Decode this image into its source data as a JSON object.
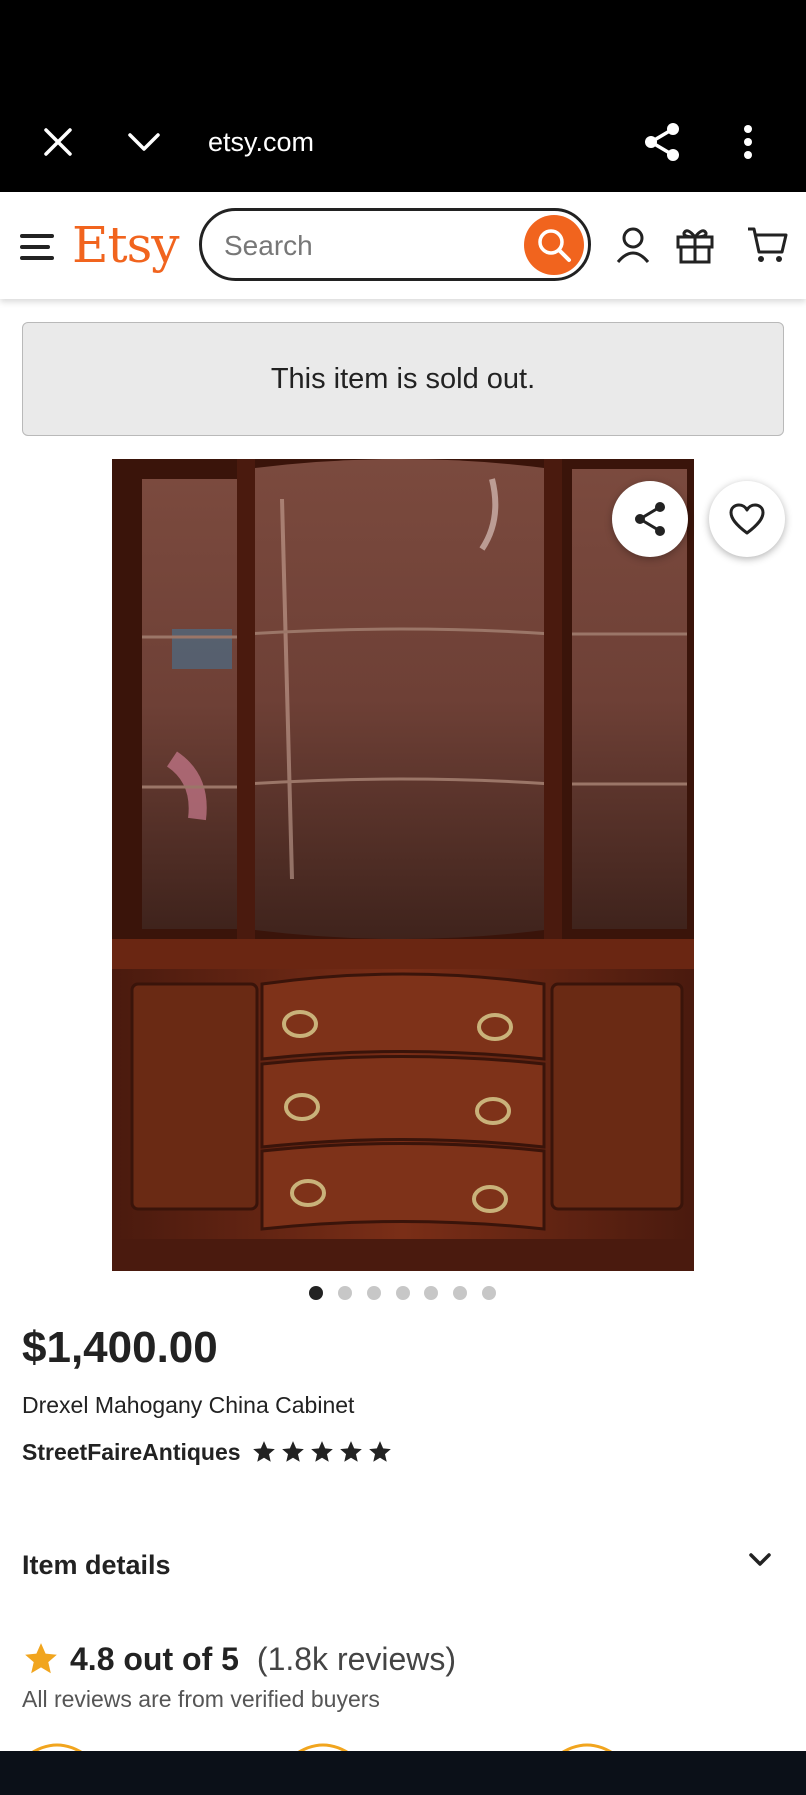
{
  "browser": {
    "url": "etsy.com"
  },
  "header": {
    "logo": "Etsy",
    "search_placeholder": "Search",
    "brand_color": "#F1641E"
  },
  "notice": {
    "sold_out": "This item is sold out."
  },
  "gallery": {
    "image_count": 7,
    "active_index": 0
  },
  "product": {
    "price": "$1,400.00",
    "title": "Drexel Mahogany China Cabinet",
    "shop_name": "StreetFaireAntiques",
    "shop_rating_stars": 5
  },
  "sections": {
    "item_details": "Item details"
  },
  "reviews": {
    "rating": "4.8 out of 5",
    "count": "(1.8k reviews)",
    "verified_note": "All reviews are from verified buyers"
  }
}
